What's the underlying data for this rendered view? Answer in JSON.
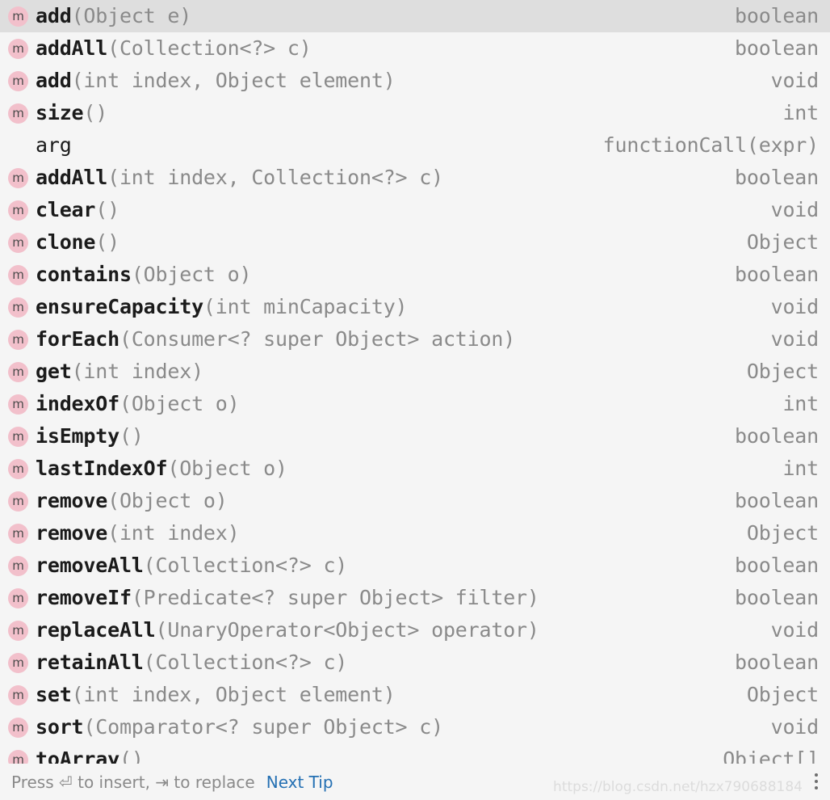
{
  "popup": {
    "kind": "code-completion-popup",
    "colors": {
      "background": "#f5f5f5",
      "selected_row": "#dedede",
      "method_icon_bg": "#f2c0cb",
      "name_text": "#1b1b1b",
      "muted_text": "#8a8a8a",
      "link": "#2470b3"
    }
  },
  "completion_items": [
    {
      "icon": "method-icon",
      "icon_letter": "m",
      "name": "add",
      "params": "(Object e)",
      "type": "boolean",
      "selected": true
    },
    {
      "icon": "method-icon",
      "icon_letter": "m",
      "name": "addAll",
      "params": "(Collection<?> c)",
      "type": "boolean",
      "selected": false
    },
    {
      "icon": "method-icon",
      "icon_letter": "m",
      "name": "add",
      "params": "(int index, Object element)",
      "type": "void",
      "selected": false
    },
    {
      "icon": "method-icon",
      "icon_letter": "m",
      "name": "size",
      "params": "()",
      "type": "int",
      "selected": false
    },
    {
      "icon": "none",
      "icon_letter": "",
      "name": "arg",
      "params": "",
      "type": "functionCall(expr)",
      "selected": false
    },
    {
      "icon": "method-icon",
      "icon_letter": "m",
      "name": "addAll",
      "params": "(int index, Collection<?> c)",
      "type": "boolean",
      "selected": false
    },
    {
      "icon": "method-icon",
      "icon_letter": "m",
      "name": "clear",
      "params": "()",
      "type": "void",
      "selected": false
    },
    {
      "icon": "method-icon",
      "icon_letter": "m",
      "name": "clone",
      "params": "()",
      "type": "Object",
      "selected": false
    },
    {
      "icon": "method-icon",
      "icon_letter": "m",
      "name": "contains",
      "params": "(Object o)",
      "type": "boolean",
      "selected": false
    },
    {
      "icon": "method-icon",
      "icon_letter": "m",
      "name": "ensureCapacity",
      "params": "(int minCapacity)",
      "type": "void",
      "selected": false
    },
    {
      "icon": "method-icon",
      "icon_letter": "m",
      "name": "forEach",
      "params": "(Consumer<? super Object> action)",
      "type": "void",
      "selected": false
    },
    {
      "icon": "method-icon",
      "icon_letter": "m",
      "name": "get",
      "params": "(int index)",
      "type": "Object",
      "selected": false
    },
    {
      "icon": "method-icon",
      "icon_letter": "m",
      "name": "indexOf",
      "params": "(Object o)",
      "type": "int",
      "selected": false
    },
    {
      "icon": "method-icon",
      "icon_letter": "m",
      "name": "isEmpty",
      "params": "()",
      "type": "boolean",
      "selected": false
    },
    {
      "icon": "method-icon",
      "icon_letter": "m",
      "name": "lastIndexOf",
      "params": "(Object o)",
      "type": "int",
      "selected": false
    },
    {
      "icon": "method-icon",
      "icon_letter": "m",
      "name": "remove",
      "params": "(Object o)",
      "type": "boolean",
      "selected": false
    },
    {
      "icon": "method-icon",
      "icon_letter": "m",
      "name": "remove",
      "params": "(int index)",
      "type": "Object",
      "selected": false
    },
    {
      "icon": "method-icon",
      "icon_letter": "m",
      "name": "removeAll",
      "params": "(Collection<?> c)",
      "type": "boolean",
      "selected": false
    },
    {
      "icon": "method-icon",
      "icon_letter": "m",
      "name": "removeIf",
      "params": "(Predicate<? super Object> filter)",
      "type": "boolean",
      "selected": false
    },
    {
      "icon": "method-icon",
      "icon_letter": "m",
      "name": "replaceAll",
      "params": "(UnaryOperator<Object> operator)",
      "type": "void",
      "selected": false
    },
    {
      "icon": "method-icon",
      "icon_letter": "m",
      "name": "retainAll",
      "params": "(Collection<?> c)",
      "type": "boolean",
      "selected": false
    },
    {
      "icon": "method-icon",
      "icon_letter": "m",
      "name": "set",
      "params": "(int index, Object element)",
      "type": "Object",
      "selected": false
    },
    {
      "icon": "method-icon",
      "icon_letter": "m",
      "name": "sort",
      "params": "(Comparator<? super Object> c)",
      "type": "void",
      "selected": false
    },
    {
      "icon": "method-icon",
      "icon_letter": "m",
      "name": "toArray",
      "params": "()",
      "type": "Object[]",
      "selected": false
    }
  ],
  "status_bar": {
    "hint": "Press ⏎ to insert, ⇥ to replace",
    "next_tip_label": "Next Tip",
    "watermark": "https://blog.csdn.net/hzx790688184",
    "menu_icon": "kebab-menu-icon"
  }
}
